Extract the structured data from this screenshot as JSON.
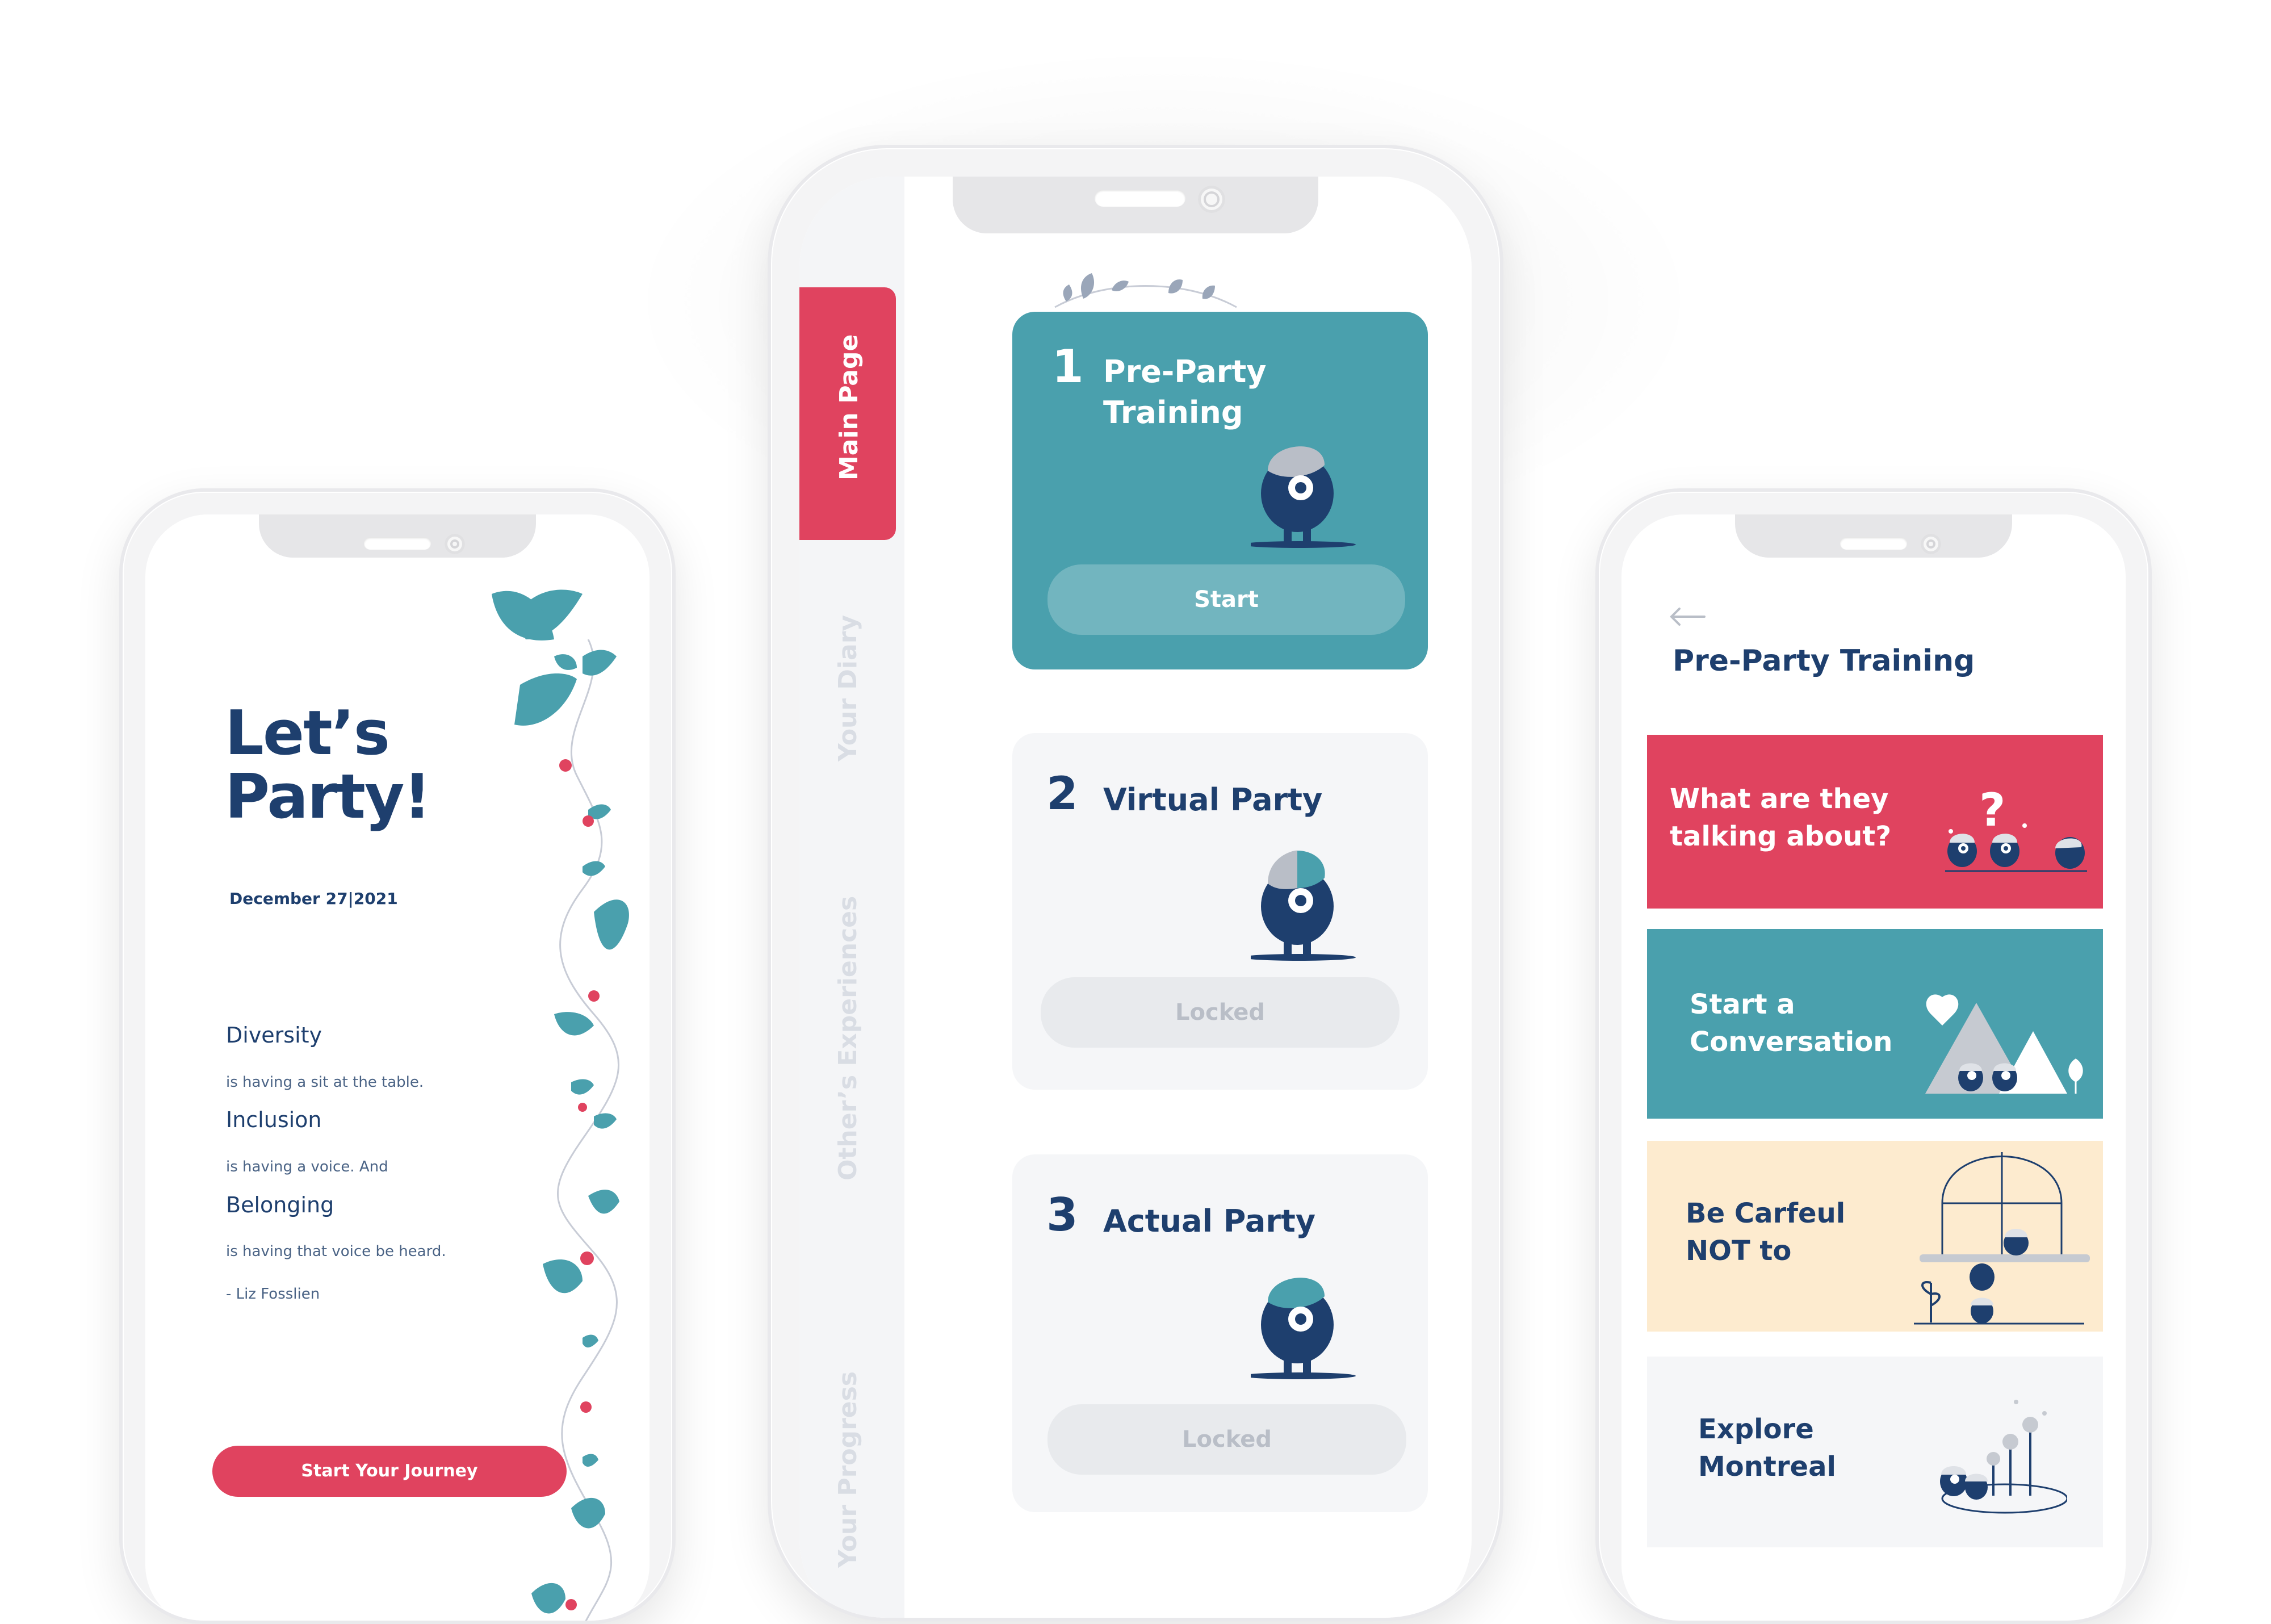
{
  "colors": {
    "navy": "#1e3f6e",
    "teal": "#4aa0ad",
    "pink": "#e0435f",
    "cream": "#fdebcf",
    "light_gray": "#f5f6f8",
    "locked_gray": "#e8eaed"
  },
  "left_phone": {
    "title_line1": "Let’s",
    "title_line2": "Party!",
    "date": "December 27|2021",
    "quote": {
      "word1": "Diversity",
      "line1": "is having a sit at the table.",
      "word2": "Inclusion",
      "line2": "is having a voice. And",
      "word3": "Belonging",
      "line3": "is having that voice be heard.",
      "author": "- Liz Fosslien"
    },
    "cta": "Start Your Journey"
  },
  "middle_phone": {
    "nav_tabs": [
      {
        "label": "Main Page"
      },
      {
        "label": "Your Diary"
      },
      {
        "label": "Other’s Experiences"
      },
      {
        "label": "Your Progress"
      }
    ],
    "cards": [
      {
        "number": "1",
        "title_line1": "Pre-Party",
        "title_line2": "Training",
        "button": "Start"
      },
      {
        "number": "2",
        "title_line1": "Virtual Party",
        "button": "Locked"
      },
      {
        "number": "3",
        "title_line1": "Actual Party",
        "button": "Locked"
      }
    ]
  },
  "right_phone": {
    "back_icon": "arrow-left-icon",
    "title": "Pre-Party Training",
    "tiles": [
      {
        "line1": "What are they",
        "line2": "talking about?"
      },
      {
        "line1": "Start a",
        "line2": "Conversation"
      },
      {
        "line1": "Be Carfeul",
        "line2": "NOT to"
      },
      {
        "line1": "Explore",
        "line2": "Montreal"
      }
    ]
  }
}
